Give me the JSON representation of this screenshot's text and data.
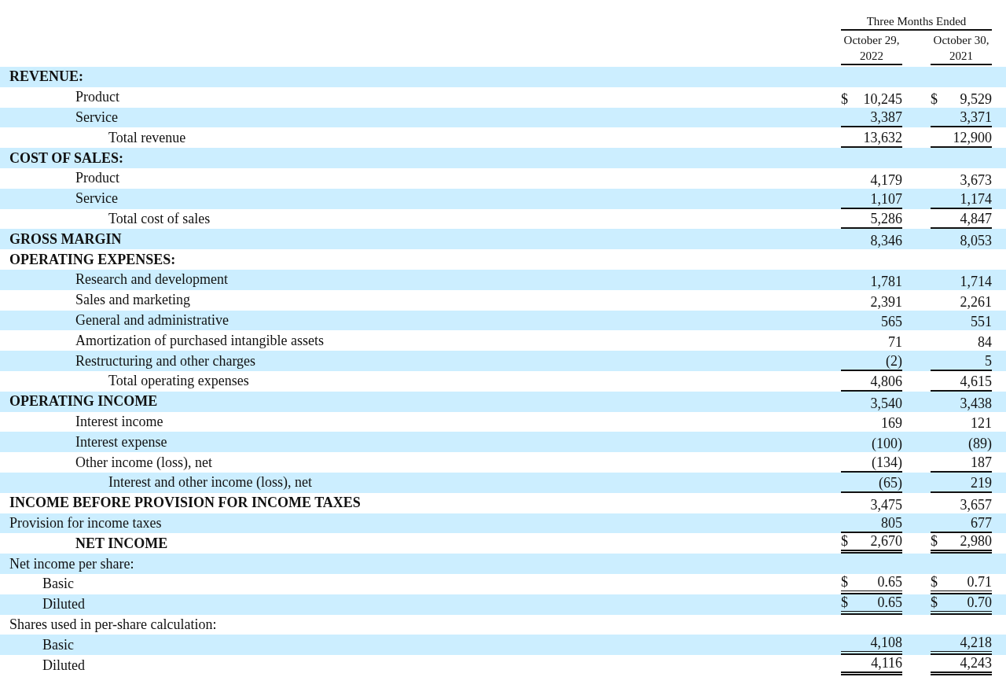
{
  "header": {
    "group": "Three Months Ended",
    "columns": [
      [
        "October 29,",
        "2022"
      ],
      [
        "October 30,",
        "2021"
      ]
    ]
  },
  "rows": [
    {
      "kind": "heading",
      "label": "REVENUE:"
    },
    {
      "kind": "line",
      "label": "Product",
      "cells": [
        {
          "sym": "$",
          "value": "10,245"
        },
        {
          "sym": "$",
          "value": "9,529"
        }
      ],
      "underlined": false,
      "double_underlined": false
    },
    {
      "kind": "line",
      "label": "Service",
      "cells": [
        {
          "value": "3,387"
        },
        {
          "value": "3,371"
        }
      ],
      "underlined": true,
      "double_underlined": false
    },
    {
      "kind": "subtotal",
      "label": "Total revenue",
      "cells": [
        {
          "value": "13,632"
        },
        {
          "value": "12,900"
        }
      ],
      "underlined": true,
      "double_underlined": false
    },
    {
      "kind": "heading",
      "label": "COST OF SALES:"
    },
    {
      "kind": "line",
      "label": "Product",
      "cells": [
        {
          "value": "4,179"
        },
        {
          "value": "3,673"
        }
      ],
      "underlined": false,
      "double_underlined": false
    },
    {
      "kind": "line",
      "label": "Service",
      "cells": [
        {
          "value": "1,107"
        },
        {
          "value": "1,174"
        }
      ],
      "underlined": true,
      "double_underlined": false
    },
    {
      "kind": "subtotal",
      "label": "Total cost of sales",
      "cells": [
        {
          "value": "5,286"
        },
        {
          "value": "4,847"
        }
      ],
      "underlined": true,
      "double_underlined": false
    },
    {
      "kind": "heading",
      "label": "GROSS MARGIN",
      "cells": [
        {
          "value": "8,346"
        },
        {
          "value": "8,053"
        }
      ],
      "underlined": false,
      "double_underlined": false
    },
    {
      "kind": "heading",
      "label": "OPERATING EXPENSES:"
    },
    {
      "kind": "line",
      "label": "Research and development",
      "cells": [
        {
          "value": "1,781"
        },
        {
          "value": "1,714"
        }
      ],
      "underlined": false,
      "double_underlined": false
    },
    {
      "kind": "line",
      "label": "Sales and marketing",
      "cells": [
        {
          "value": "2,391"
        },
        {
          "value": "2,261"
        }
      ],
      "underlined": false,
      "double_underlined": false
    },
    {
      "kind": "line",
      "label": "General and administrative",
      "cells": [
        {
          "value": "565"
        },
        {
          "value": "551"
        }
      ],
      "underlined": false,
      "double_underlined": false
    },
    {
      "kind": "line",
      "label": "Amortization of purchased intangible assets",
      "cells": [
        {
          "value": "71"
        },
        {
          "value": "84"
        }
      ],
      "underlined": false,
      "double_underlined": false
    },
    {
      "kind": "line",
      "label": "Restructuring and other charges",
      "cells": [
        {
          "value": "(2)"
        },
        {
          "value": "5"
        }
      ],
      "underlined": true,
      "double_underlined": false
    },
    {
      "kind": "subtotal",
      "label": "Total operating expenses",
      "cells": [
        {
          "value": "4,806"
        },
        {
          "value": "4,615"
        }
      ],
      "underlined": true,
      "double_underlined": false
    },
    {
      "kind": "heading",
      "label": "OPERATING INCOME",
      "cells": [
        {
          "value": "3,540"
        },
        {
          "value": "3,438"
        }
      ],
      "underlined": false,
      "double_underlined": false
    },
    {
      "kind": "line",
      "label": "Interest income",
      "cells": [
        {
          "value": "169"
        },
        {
          "value": "121"
        }
      ],
      "underlined": false,
      "double_underlined": false
    },
    {
      "kind": "line",
      "label": "Interest expense",
      "cells": [
        {
          "value": "(100)"
        },
        {
          "value": "(89)"
        }
      ],
      "underlined": false,
      "double_underlined": false
    },
    {
      "kind": "line",
      "label": "Other income (loss), net",
      "cells": [
        {
          "value": "(134)"
        },
        {
          "value": "187"
        }
      ],
      "underlined": true,
      "double_underlined": false
    },
    {
      "kind": "subtotal",
      "label": "Interest and other income (loss), net",
      "cells": [
        {
          "value": "(65)"
        },
        {
          "value": "219"
        }
      ],
      "underlined": true,
      "double_underlined": false
    },
    {
      "kind": "heading",
      "label": "INCOME BEFORE PROVISION FOR INCOME TAXES",
      "cells": [
        {
          "value": "3,475"
        },
        {
          "value": "3,657"
        }
      ],
      "underlined": false,
      "double_underlined": false
    },
    {
      "kind": "plain",
      "label": "Provision for income taxes",
      "cells": [
        {
          "value": "805"
        },
        {
          "value": "677"
        }
      ],
      "underlined": true,
      "double_underlined": false
    },
    {
      "kind": "net",
      "label": "NET INCOME",
      "cells": [
        {
          "sym": "$",
          "value": "2,670"
        },
        {
          "sym": "$",
          "value": "2,980"
        }
      ],
      "underlined": true,
      "double_underlined": true
    },
    {
      "kind": "plain",
      "label": "Net income per share:"
    },
    {
      "kind": "subline",
      "label": "Basic",
      "cells": [
        {
          "sym": "$",
          "value": "0.65"
        },
        {
          "sym": "$",
          "value": "0.71"
        }
      ],
      "underlined": true,
      "double_underlined": true
    },
    {
      "kind": "subline",
      "label": "Diluted",
      "cells": [
        {
          "sym": "$",
          "value": "0.65"
        },
        {
          "sym": "$",
          "value": "0.70"
        }
      ],
      "underlined": true,
      "double_underlined": true
    },
    {
      "kind": "plain",
      "label": "Shares used in per-share calculation:"
    },
    {
      "kind": "subline",
      "label": "Basic",
      "cells": [
        {
          "value": "4,108"
        },
        {
          "value": "4,218"
        }
      ],
      "underlined": true,
      "double_underlined": true
    },
    {
      "kind": "subline",
      "label": "Diluted",
      "cells": [
        {
          "value": "4,116"
        },
        {
          "value": "4,243"
        }
      ],
      "underlined": true,
      "double_underlined": true
    }
  ]
}
